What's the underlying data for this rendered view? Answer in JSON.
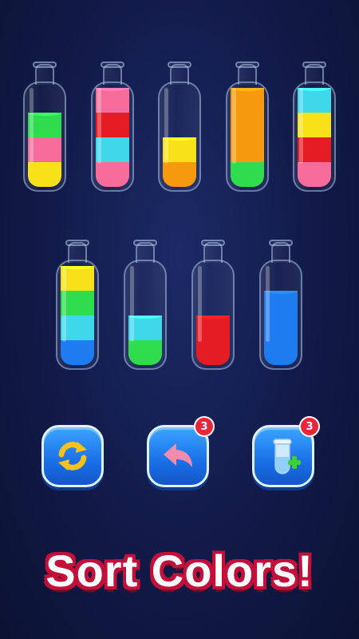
{
  "bottles": [
    {
      "layers": [
        "#f7e21a",
        "#f76c9a",
        "#2fdc4e"
      ]
    },
    {
      "layers": [
        "#f76c9a",
        "#3fd7ea",
        "#e61c25",
        "#f76c9a"
      ]
    },
    {
      "layers": [
        "#f59a0e",
        "#f7e21a"
      ]
    },
    {
      "layers": [
        "#2fdc4e",
        "#f59a0e",
        "#f59a0e",
        "#f59a0e"
      ]
    },
    {
      "layers": [
        "#f76c9a",
        "#e61c25",
        "#f7e21a",
        "#3fd7ea"
      ]
    },
    {
      "layers": [
        "#1f7cf0",
        "#3fd7ea",
        "#2fdc4e",
        "#f7e21a"
      ]
    },
    {
      "layers": [
        "#2fdc4e",
        "#3fd7ea"
      ]
    },
    {
      "layers": [
        "#e61c25",
        "#e61c25"
      ]
    },
    {
      "layers": [
        "#1f7cf0",
        "#1f7cf0",
        "#1f7cf0"
      ]
    }
  ],
  "controls": {
    "restart": {
      "icon": "restart-arrows-icon"
    },
    "undo": {
      "icon": "undo-arrow-icon",
      "count": "3"
    },
    "add_bottle": {
      "icon": "add-tube-icon",
      "count": "3"
    }
  },
  "title": "Sort Colors!",
  "colors": {
    "button": "#1a6fe8",
    "badge": "#e8273a",
    "title_outline": "#c3103a"
  }
}
